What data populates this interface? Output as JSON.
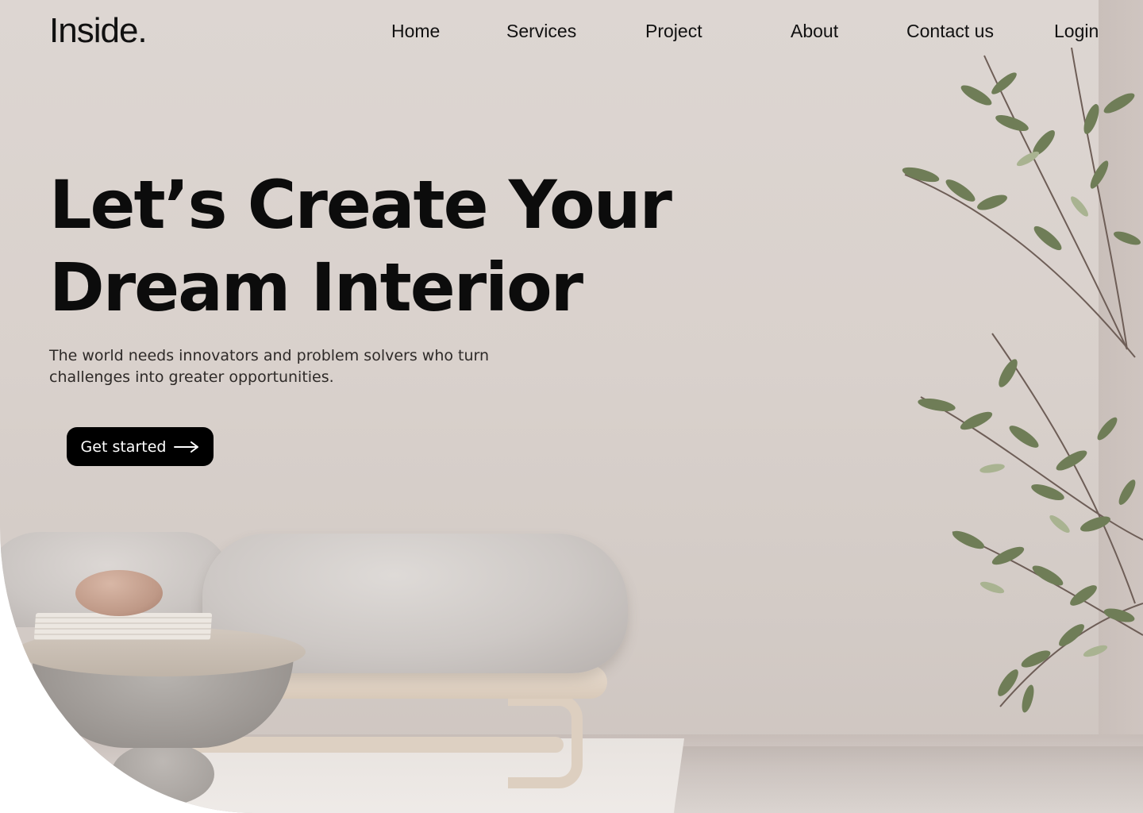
{
  "nav": {
    "logo": "Inside.",
    "links": [
      "Home",
      "Services",
      "Project",
      "About",
      "Contact us"
    ],
    "login": "Login"
  },
  "hero": {
    "headline_line1": "Let’s Create Your",
    "headline_line2": "Dream Interior",
    "subtext": "The world needs innovators and problem solvers who turn challenges into greater opportunities.",
    "cta_label": "Get started",
    "cta_icon": "arrow-right-icon"
  },
  "colors": {
    "text": "#111111",
    "cta_background": "#000000",
    "cta_text": "#ffffff",
    "wall": "#dbd4d0",
    "leaf": "#6f7d57"
  }
}
